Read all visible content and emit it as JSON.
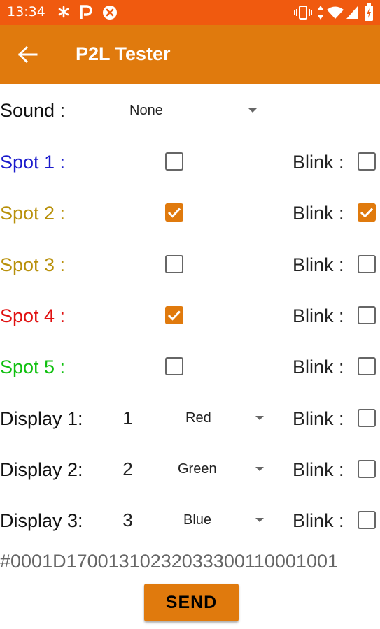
{
  "status_bar": {
    "time": "13:34",
    "icons": [
      "asterisk-icon",
      "p-badge-icon",
      "blocked-icon",
      "vibrate-icon",
      "data-arrows-icon",
      "wifi-icon",
      "signal-icon",
      "battery-icon"
    ],
    "color": "#F05A0F"
  },
  "app_bar": {
    "title": "P2L Tester",
    "color": "#E07A0D"
  },
  "sound": {
    "label": "Sound :",
    "value": "None"
  },
  "spots": [
    {
      "label": "Spot 1 :",
      "color": "#1A1ACC",
      "checked": false,
      "blink_label": "Blink :",
      "blink_checked": false
    },
    {
      "label": "Spot 2 :",
      "color": "#B8900A",
      "checked": true,
      "blink_label": "Blink :",
      "blink_checked": true
    },
    {
      "label": "Spot 3 :",
      "color": "#B8900A",
      "checked": false,
      "blink_label": "Blink :",
      "blink_checked": false
    },
    {
      "label": "Spot 4 :",
      "color": "#E01010",
      "checked": true,
      "blink_label": "Blink :",
      "blink_checked": false
    },
    {
      "label": "Spot 5 :",
      "color": "#10C010",
      "checked": false,
      "blink_label": "Blink :",
      "blink_checked": false
    }
  ],
  "displays": [
    {
      "label": "Display 1:",
      "number": "1",
      "color_value": "Red",
      "blink_label": "Blink :",
      "blink_checked": false
    },
    {
      "label": "Display 2:",
      "number": "2",
      "color_value": "Green",
      "blink_label": "Blink :",
      "blink_checked": false
    },
    {
      "label": "Display 3:",
      "number": "3",
      "color_value": "Blue",
      "blink_label": "Blink :",
      "blink_checked": false
    }
  ],
  "output_string": "#0001D17001310232033300110001001",
  "send_label": "SEND",
  "accent_color": "#E07A0D"
}
